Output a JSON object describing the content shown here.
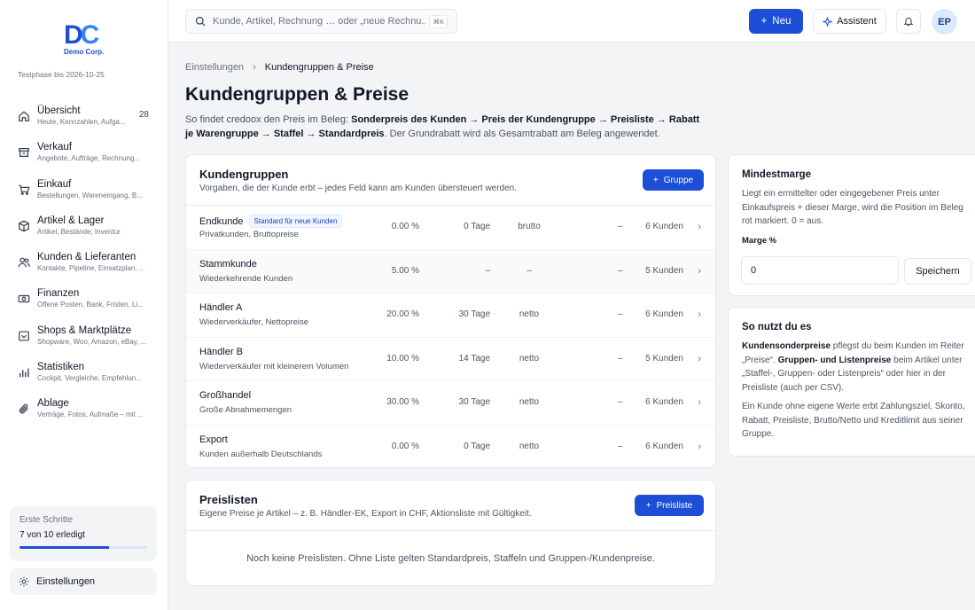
{
  "brand": {
    "logo_letters": [
      "D",
      "C"
    ],
    "logo_sub": "Demo Corp.",
    "trial": "Testphase bis 2026-10-25"
  },
  "nav": [
    {
      "title": "Übersicht",
      "sub": "Heute, Kennzahlen, Aufga...",
      "count": "28",
      "icon": "home-icon"
    },
    {
      "title": "Verkauf",
      "sub": "Angebote, Aufträge, Rechnung...",
      "count": "",
      "icon": "archive-icon"
    },
    {
      "title": "Einkauf",
      "sub": "Bestellungen, Wareneingang, B...",
      "count": "",
      "icon": "cart-icon"
    },
    {
      "title": "Artikel & Lager",
      "sub": "Artikel, Bestände, Inventur",
      "count": "",
      "icon": "box-icon"
    },
    {
      "title": "Kunden & Lieferanten",
      "sub": "Kontakte, Pipeline, Einsatzplan, ...",
      "count": "",
      "icon": "users-icon"
    },
    {
      "title": "Finanzen",
      "sub": "Offene Posten, Bank, Fristen, Li...",
      "count": "",
      "icon": "cash-icon"
    },
    {
      "title": "Shops & Marktplätze",
      "sub": "Shopware, Woo, Amazon, eBay, ...",
      "count": "",
      "icon": "shop-icon"
    },
    {
      "title": "Statistiken",
      "sub": "Cockpit, Vergleiche, Empfehlun...",
      "count": "",
      "icon": "chart-icon"
    },
    {
      "title": "Ablage",
      "sub": "Verträge, Fotos, Aufmaße – mit ...",
      "count": "",
      "icon": "paperclip-icon"
    }
  ],
  "steps": {
    "title": "Erste Schritte",
    "count": "7 von 10 erledigt",
    "progress": 0.7
  },
  "settings_label": "Einstellungen",
  "topbar": {
    "search_placeholder": "Kunde, Artikel, Rechnung … oder „neue Rechnu...",
    "kbd": "⌘K",
    "new_label": "Neu",
    "assistant_label": "Assistent",
    "avatar": "EP"
  },
  "breadcrumb": {
    "parent": "Einstellungen",
    "sep": "›",
    "current": "Kundengruppen & Preise"
  },
  "page": {
    "title": "Kundengruppen & Preise",
    "desc_intro": "So findet credoox den Preis im Beleg: ",
    "desc_bold": "Sonderpreis des Kunden → Preis der Kundengruppe → Preisliste → Rabatt je Warengruppe → Staffel → Standardpreis",
    "desc_tail": ". Der Grundrabatt wird als Gesamtrabatt am Beleg angewendet."
  },
  "groups": {
    "title": "Kundengruppen",
    "sub": "Vorgaben, die der Kunde erbt – jedes Feld kann am Kunden übersteuert werden.",
    "add_label": "Gruppe",
    "rows": [
      {
        "name": "Endkunde",
        "badge": "Standard für neue Kunden",
        "desc": "Privatkunden, Bruttopreise",
        "pct": "0.00 %",
        "days": "0 Tage",
        "mode": "brutto",
        "extra": "–",
        "count": "6 Kunden"
      },
      {
        "name": "Stammkunde",
        "badge": "",
        "desc": "Wiederkehrende Kunden",
        "pct": "5.00 %",
        "days": "–",
        "mode": "–",
        "extra": "–",
        "count": "5 Kunden"
      },
      {
        "name": "Händler A",
        "badge": "",
        "desc": "Wiederverkäufer, Nettopreise",
        "pct": "20.00 %",
        "days": "30 Tage",
        "mode": "netto",
        "extra": "–",
        "count": "6 Kunden"
      },
      {
        "name": "Händler B",
        "badge": "",
        "desc": "Wiederverkäufer mit kleinerem Volumen",
        "pct": "10.00 %",
        "days": "14 Tage",
        "mode": "netto",
        "extra": "–",
        "count": "5 Kunden"
      },
      {
        "name": "Großhandel",
        "badge": "",
        "desc": "Große Abnahmemengen",
        "pct": "30.00 %",
        "days": "30 Tage",
        "mode": "netto",
        "extra": "–",
        "count": "6 Kunden"
      },
      {
        "name": "Export",
        "badge": "",
        "desc": "Kunden außerhalb Deutschlands",
        "pct": "0.00 %",
        "days": "0 Tage",
        "mode": "netto",
        "extra": "–",
        "count": "6 Kunden"
      }
    ]
  },
  "pricelists": {
    "title": "Preislisten",
    "sub": "Eigene Preise je Artikel – z. B. Händler-EK, Export in CHF, Aktionsliste mit Gültigkeit.",
    "add_label": "Preisliste",
    "empty": "Noch keine Preislisten. Ohne Liste gelten Standardpreis, Staffeln und Gruppen-/Kundenpreise."
  },
  "margin": {
    "title": "Mindestmarge",
    "text": "Liegt ein ermittelter oder eingegebener Preis unter Einkaufspreis + dieser Marge, wird die Position im Beleg rot markiert. 0 = aus.",
    "label": "Marge %",
    "value": "0",
    "save": "Speichern"
  },
  "usage": {
    "title": "So nutzt du es",
    "p1_b1": "Kundensonderpreise",
    "p1_t1": " pflegst du beim Kunden im Reiter „Preise“. ",
    "p1_b2": "Gruppen- und Listenpreise",
    "p1_t2": " beim Artikel unter „Staffel-, Gruppen- oder Listenpreis“ oder hier in der Preisliste (auch per CSV).",
    "p2": "Ein Kunde ohne eigene Werte erbt Zahlungsziel, Skonto, Rabatt, Preisliste, Brutto/Netto und Kreditlimit aus seiner Gruppe."
  },
  "colors": {
    "accent": "#1d4ed8",
    "background": "#f3f4f6"
  }
}
